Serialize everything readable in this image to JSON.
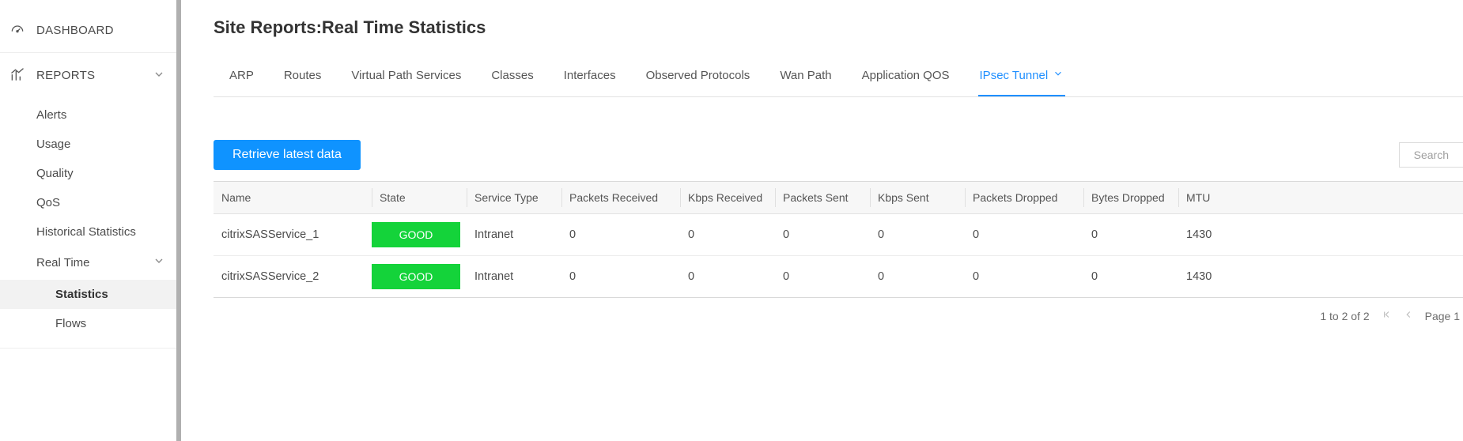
{
  "sidebar": {
    "dashboard_label": "DASHBOARD",
    "reports_label": "REPORTS",
    "items": {
      "alerts": "Alerts",
      "usage": "Usage",
      "quality": "Quality",
      "qos": "QoS",
      "historical": "Historical Statistics",
      "realtime": "Real Time",
      "statistics": "Statistics",
      "flows": "Flows"
    }
  },
  "page": {
    "title": "Site Reports:Real Time Statistics"
  },
  "tabs": {
    "arp": "ARP",
    "routes": "Routes",
    "virtual_path": "Virtual Path Services",
    "classes": "Classes",
    "interfaces": "Interfaces",
    "observed": "Observed Protocols",
    "wan_path": "Wan Path",
    "app_qos": "Application QOS",
    "ipsec": "IPsec Tunnel"
  },
  "toolbar": {
    "retrieve_label": "Retrieve latest data",
    "search_label": "Search"
  },
  "table": {
    "columns": {
      "name": "Name",
      "state": "State",
      "service_type": "Service Type",
      "packets_received": "Packets Received",
      "kbps_received": "Kbps Received",
      "packets_sent": "Packets Sent",
      "kbps_sent": "Kbps Sent",
      "packets_dropped": "Packets Dropped",
      "bytes_dropped": "Bytes Dropped",
      "mtu": "MTU"
    },
    "rows": [
      {
        "name": "citrixSASService_1",
        "state": "GOOD",
        "service_type": "Intranet",
        "packets_received": "0",
        "kbps_received": "0",
        "packets_sent": "0",
        "kbps_sent": "0",
        "packets_dropped": "0",
        "bytes_dropped": "0",
        "mtu": "1430"
      },
      {
        "name": "citrixSASService_2",
        "state": "GOOD",
        "service_type": "Intranet",
        "packets_received": "0",
        "kbps_received": "0",
        "packets_sent": "0",
        "kbps_sent": "0",
        "packets_dropped": "0",
        "bytes_dropped": "0",
        "mtu": "1430"
      }
    ]
  },
  "pager": {
    "range_text": "1 to 2 of 2",
    "page_text": "Page 1"
  }
}
